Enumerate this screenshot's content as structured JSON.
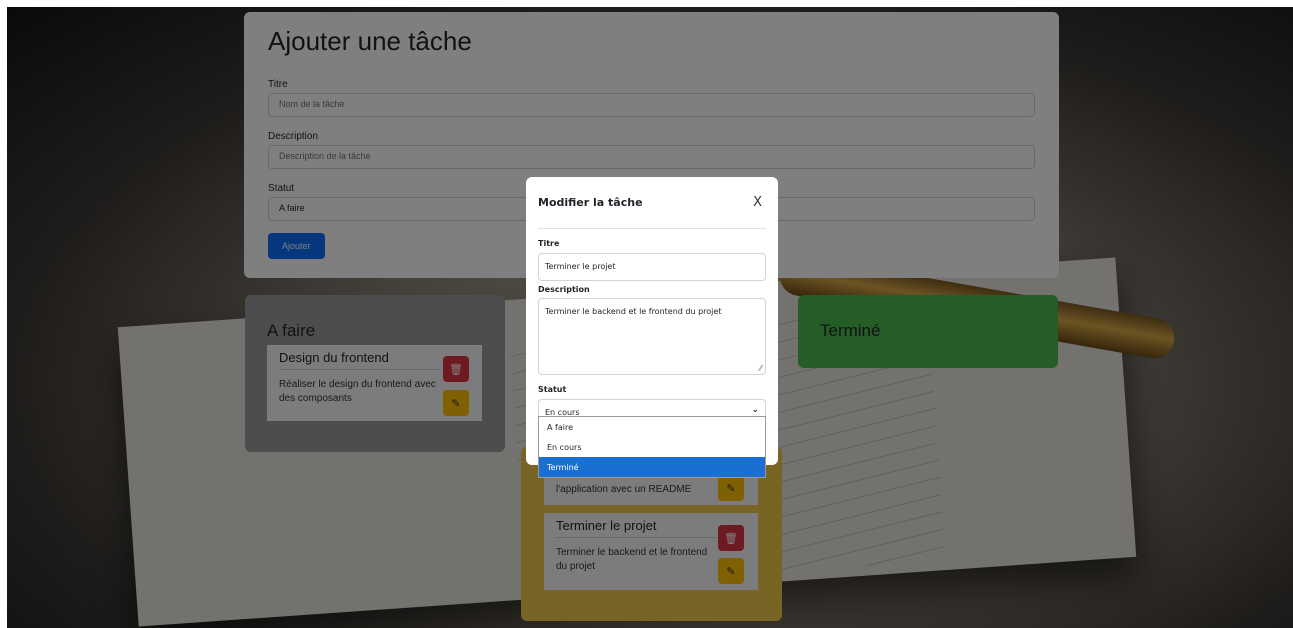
{
  "add_form": {
    "heading": "Ajouter une tâche",
    "title_label": "Titre",
    "title_placeholder": "Nom de la tâche",
    "description_label": "Description",
    "description_placeholder": "Description de la tâche",
    "status_label": "Statut",
    "status_value": "A faire",
    "submit_label": "Ajouter"
  },
  "columns": {
    "todo": {
      "title": "A faire",
      "tasks": [
        {
          "title": "Design du frontend",
          "description": "Réaliser le design du frontend avec des composants"
        }
      ]
    },
    "in_progress": {
      "tasks": [
        {
          "description_fragment": "l'application avec un README"
        },
        {
          "title": "Terminer le projet",
          "description": "Terminer le backend et le frontend du projet"
        }
      ]
    },
    "done": {
      "title": "Terminé"
    }
  },
  "modal": {
    "title": "Modifier la tâche",
    "close_label": "X",
    "title_label": "Titre",
    "title_value": "Terminer le projet",
    "description_label": "Description",
    "description_value": "Terminer le backend et le frontend du projet",
    "status_label": "Statut",
    "status_value": "En cours",
    "status_options": [
      "A faire",
      "En cours",
      "Terminé"
    ],
    "highlighted_option": "Terminé"
  },
  "icons": {
    "delete": "trash-icon",
    "edit": "pencil-icon",
    "dropdown": "chevron-down-icon"
  },
  "colors": {
    "primary": "#0d6efd",
    "todo_column": "#9a9a9a",
    "in_progress_column": "#f0c94b",
    "done_column": "#4bbb4e",
    "delete_button": "#dc3545",
    "edit_button": "#ffc107"
  }
}
